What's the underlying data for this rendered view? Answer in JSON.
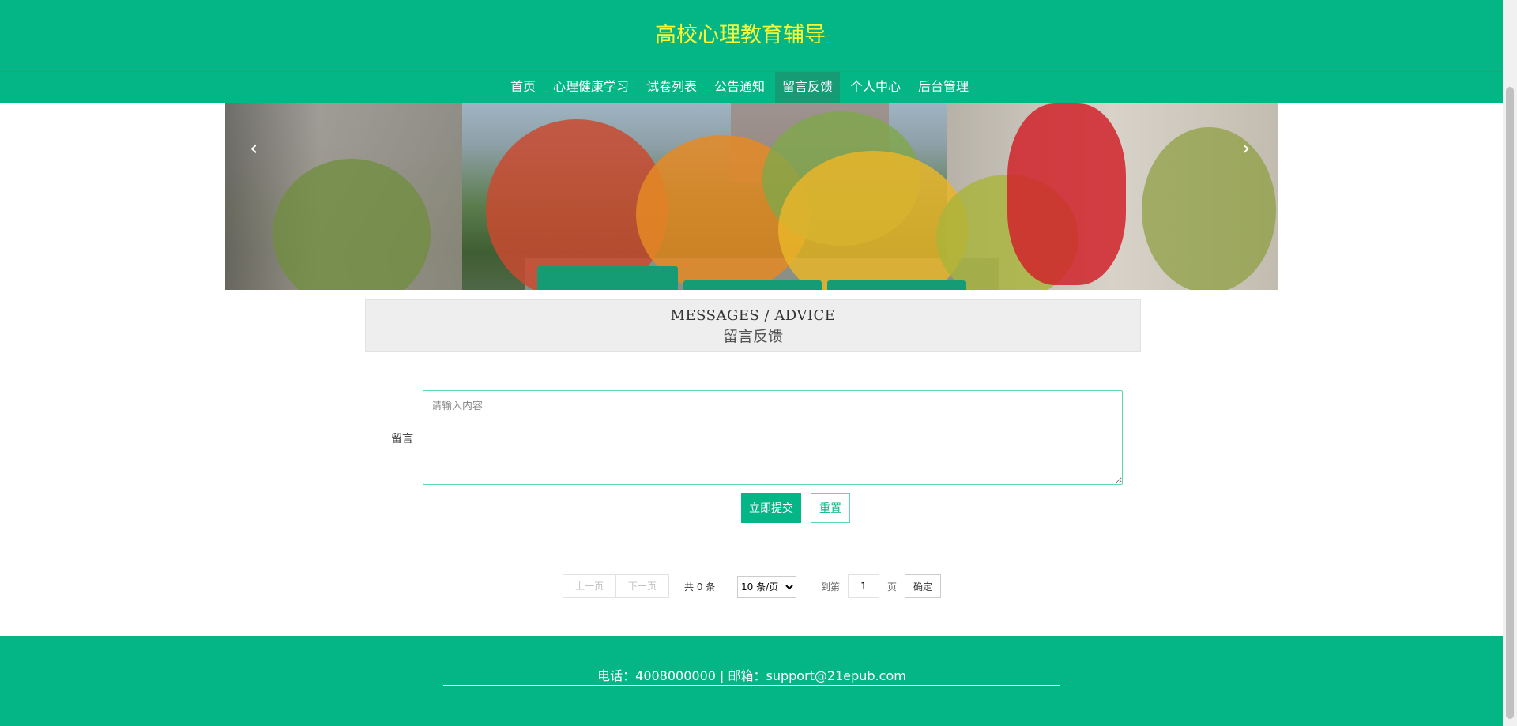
{
  "header": {
    "site_title": "高校心理教育辅导"
  },
  "nav": {
    "items": [
      {
        "label": "首页"
      },
      {
        "label": "心理健康学习"
      },
      {
        "label": "试卷列表"
      },
      {
        "label": "公告通知"
      },
      {
        "label": "留言反馈",
        "active": true
      },
      {
        "label": "个人中心"
      },
      {
        "label": "后台管理"
      }
    ]
  },
  "carousel": {
    "prev_icon": "‹",
    "next_icon": "›"
  },
  "section": {
    "title_en": "MESSAGES / ADVICE",
    "title_cn": "留言反馈"
  },
  "form": {
    "label": "留言",
    "textarea_value": "",
    "textarea_placeholder": "请输入内容",
    "submit_label": "立即提交",
    "reset_label": "重置"
  },
  "pagination": {
    "prev_label": "上一页",
    "next_label": "下一页",
    "total_label": "共 0 条",
    "page_size_selected": "10 条/页",
    "goto_label": "到第",
    "goto_value": "1",
    "page_suffix": "页",
    "confirm_label": "确定"
  },
  "footer": {
    "contact": "电话：4008000000 | 邮箱：support@21epub.com"
  },
  "colors": {
    "primary": "#04b586",
    "title": "#f6f93a",
    "nav_active": "#169c74"
  }
}
